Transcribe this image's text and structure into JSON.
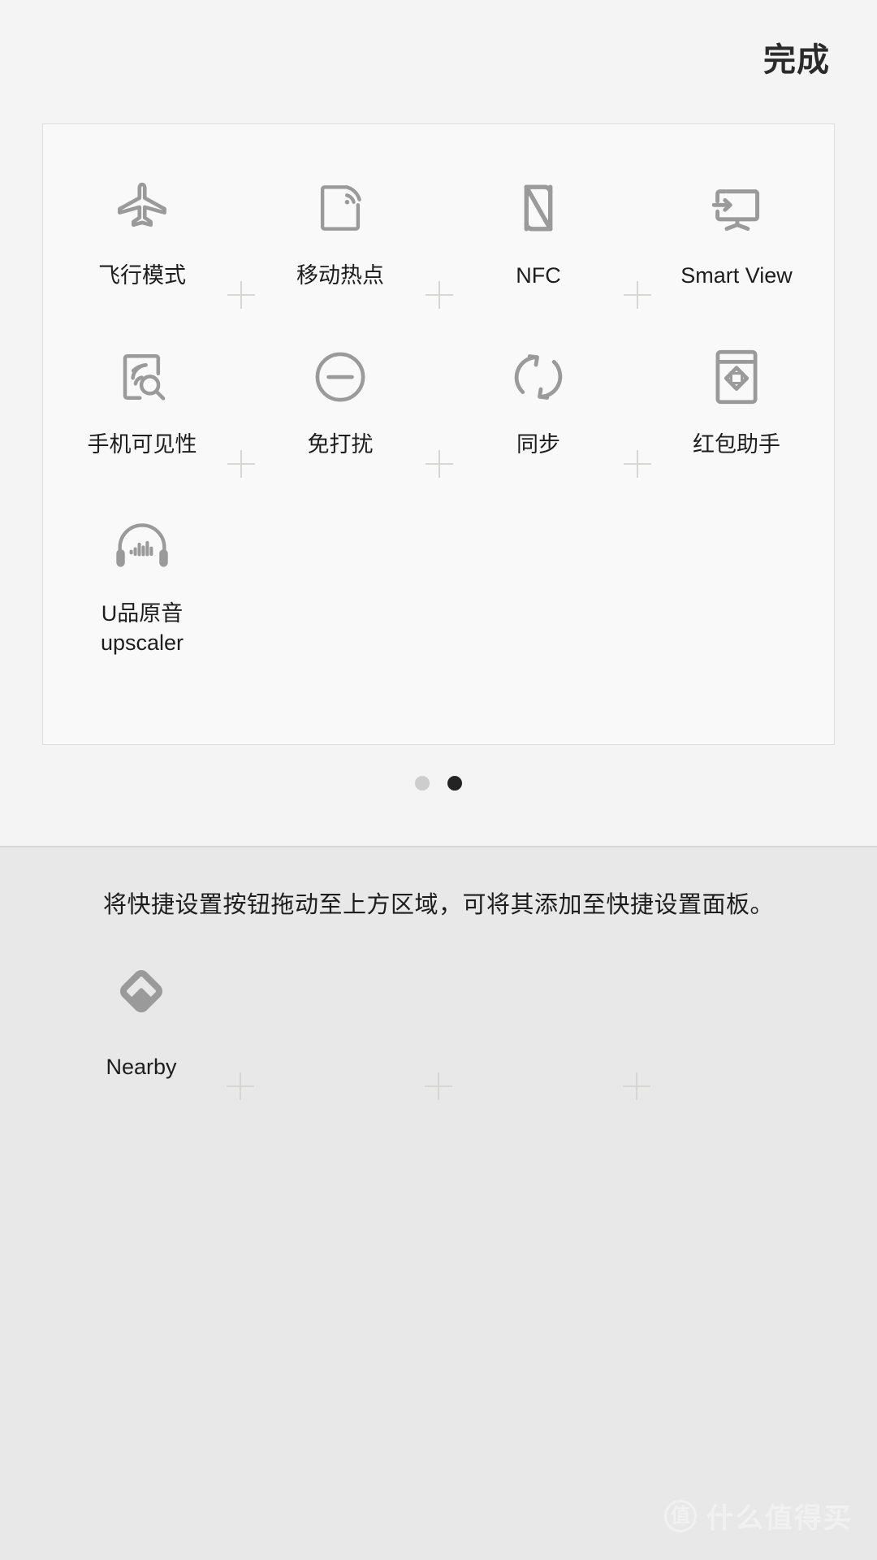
{
  "header": {
    "done_label": "完成"
  },
  "panel": {
    "page_tiles": [
      {
        "icon": "airplane-icon",
        "label": "飞行模式",
        "col": 0,
        "row": 0
      },
      {
        "icon": "mobile-hotspot-icon",
        "label": "移动热点",
        "col": 1,
        "row": 0
      },
      {
        "icon": "nfc-icon",
        "label": "NFC",
        "col": 2,
        "row": 0
      },
      {
        "icon": "smart-view-icon",
        "label": "Smart View",
        "col": 3,
        "row": 0
      },
      {
        "icon": "phone-visibility-icon",
        "label": "手机可见性",
        "col": 0,
        "row": 1
      },
      {
        "icon": "do-not-disturb-icon",
        "label": "免打扰",
        "col": 1,
        "row": 1
      },
      {
        "icon": "sync-icon",
        "label": "同步",
        "col": 2,
        "row": 1
      },
      {
        "icon": "red-packet-icon",
        "label": "红包助手",
        "col": 3,
        "row": 1
      },
      {
        "icon": "headphones-icon",
        "label": "U品原音\nupscaler",
        "col": 0,
        "row": 2
      }
    ]
  },
  "pagination": {
    "dots": [
      {
        "state": "inactive"
      },
      {
        "state": "active"
      }
    ],
    "current_page": 2,
    "total_pages": 2
  },
  "tray": {
    "hint": "将快捷设置按钮拖动至上方区域，可将其添加至快捷设置面板。",
    "tiles": [
      {
        "icon": "nearby-icon",
        "label": "Nearby",
        "col": 0,
        "row": 0
      }
    ]
  },
  "watermark": {
    "logo_glyph": "值",
    "text": "什么值得买"
  },
  "colors": {
    "top_background": "#f4f4f4",
    "panel_background": "#f9f9f9",
    "panel_border": "#dededc",
    "bottom_background": "#e8e8e8",
    "icon_gray": "#9a9a9a",
    "text_primary": "#1d1d1d",
    "dot_active": "#232323",
    "dot_inactive": "#cdcdcd",
    "plus_mark": "#d6d6d4"
  }
}
